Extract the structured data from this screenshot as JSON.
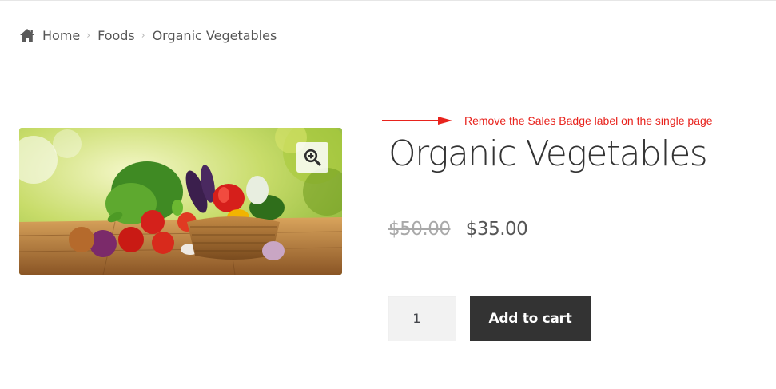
{
  "breadcrumb": {
    "home_icon": "home-icon",
    "home": "Home",
    "category": "Foods",
    "current": "Organic Vegetables",
    "separator": "›"
  },
  "product": {
    "image_alt": "Organic vegetables in a basket",
    "zoom_icon": "magnify-plus-icon",
    "title": "Organic Vegetables",
    "regular_price": "$50.00",
    "sale_price": "$35.00",
    "quantity": "1",
    "add_to_cart_label": "Add to cart"
  },
  "annotation": {
    "text": "Remove the Sales Badge label on the single page",
    "color": "#e8231d"
  },
  "colors": {
    "button_bg": "#333333",
    "text": "#555555",
    "muted": "#a9a9a9"
  }
}
